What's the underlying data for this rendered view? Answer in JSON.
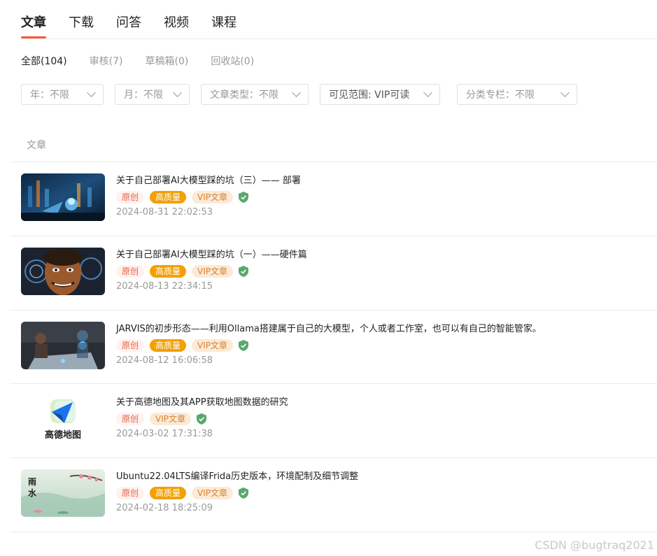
{
  "tabs": [
    {
      "label": "文章",
      "active": true
    },
    {
      "label": "下载"
    },
    {
      "label": "问答"
    },
    {
      "label": "视频"
    },
    {
      "label": "课程"
    }
  ],
  "subtabs": [
    {
      "label": "全部(104)",
      "active": true
    },
    {
      "label": "审核(7)"
    },
    {
      "label": "草稿箱(0)"
    },
    {
      "label": "回收站(0)"
    }
  ],
  "filters": [
    {
      "label": "年：不限"
    },
    {
      "label": "月：不限"
    },
    {
      "label": "文章类型：不限"
    },
    {
      "label": "可见范围: VIP可读"
    },
    {
      "label": "分类专栏：不限"
    }
  ],
  "list_header": "文章",
  "tag_labels": {
    "original": "原创",
    "high_quality": "高质量",
    "vip": "VIP文章"
  },
  "articles": [
    {
      "title": "关于自己部署AI大模型踩的坑（三）—— 部署",
      "date": "2024-08-31 22:02:53",
      "tags": [
        "原创",
        "高质量",
        "VIP文章"
      ],
      "thumbnail": "robot-ai-art"
    },
    {
      "title": "关于自己部署AI大模型踩的坑（一）——硬件篇",
      "date": "2024-08-13 22:34:15",
      "tags": [
        "原创",
        "高质量",
        "VIP文章"
      ],
      "thumbnail": "face-art"
    },
    {
      "title": "JARVIS的初步形态——利用Ollama搭建属于自己的大模型，个人或者工作室，也可以有自己的智能管家。",
      "date": "2024-08-12 16:06:58",
      "tags": [
        "原创",
        "高质量",
        "VIP文章"
      ],
      "thumbnail": "workshop-art"
    },
    {
      "title": "关于高德地图及其APP获取地图数据的研究",
      "date": "2024-03-02 17:31:38",
      "tags": [
        "原创",
        "VIP文章"
      ],
      "thumbnail": "amap-logo",
      "logo_text": "高德地图"
    },
    {
      "title": "Ubuntu22.04LTS编译Frida历史版本，环境配制及细节调整",
      "date": "2024-02-18 18:25:09",
      "tags": [
        "原创",
        "高质量",
        "VIP文章"
      ],
      "thumbnail": "rain-painting",
      "logo_text": "雨水"
    }
  ],
  "watermark": "CSDN @bugtraq2021",
  "colors": {
    "accent": "#fc5531",
    "hq_tag": "#f4a000",
    "vip_tag_bg": "#fbead7",
    "verified": "#5aa86c"
  }
}
